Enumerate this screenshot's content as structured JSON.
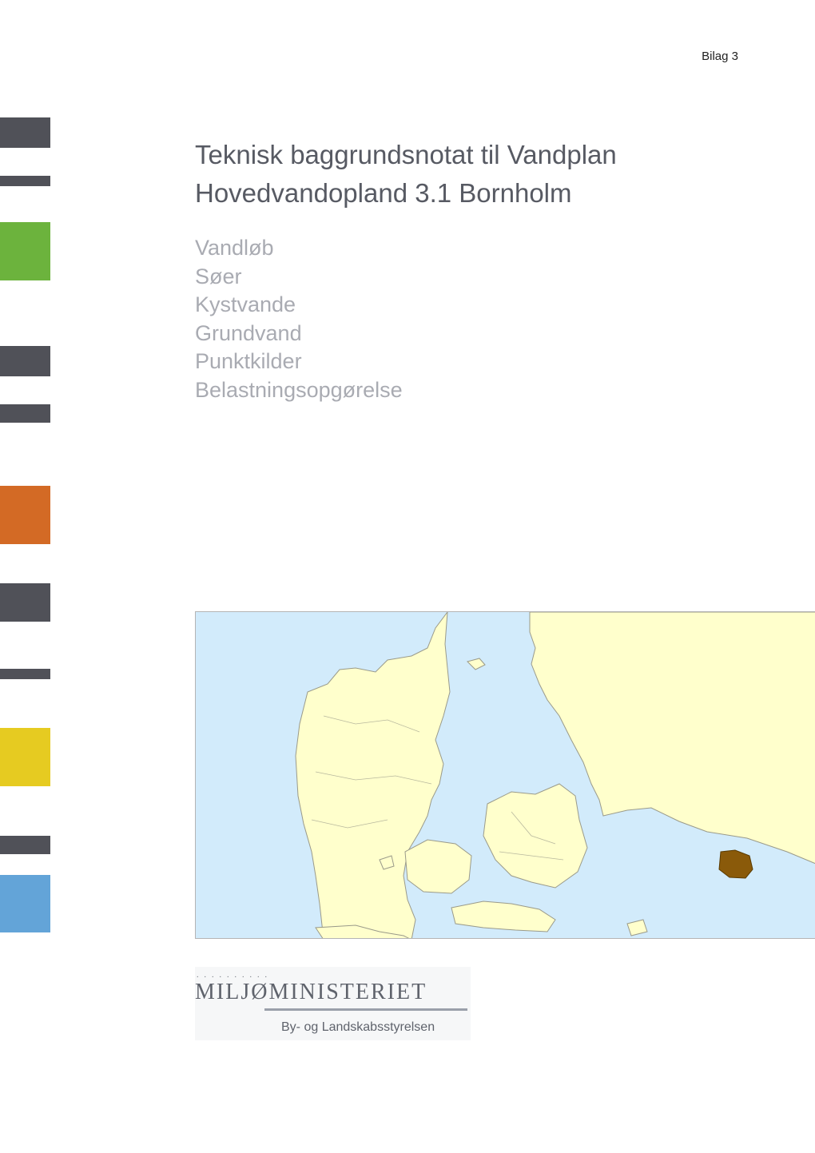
{
  "header": {
    "appendix_label": "Bilag 3"
  },
  "title": {
    "line1": "Teknisk baggrundsnotat til Vandplan",
    "line2": "Hovedvandopland 3.1 Bornholm"
  },
  "topics": [
    "Vandløb",
    "Søer",
    "Kystvande",
    "Grundvand",
    "Punktkilder",
    "Belastningsopgørelse"
  ],
  "sidebar": {
    "colors": {
      "gray": "#505158",
      "green": "#6cb33d",
      "orange": "#d36a25",
      "yellow": "#e6cb21",
      "blue": "#63a4d8"
    }
  },
  "map": {
    "colors": {
      "sea": "#d2ebfb",
      "land": "#ffffcc",
      "border": "#9a9a8a",
      "highlight": "#8a5a0a"
    },
    "highlighted_region": "Bornholm"
  },
  "logo": {
    "dots": "..........",
    "name": "MILJØMINISTERIET",
    "agency": "By- og Landskabsstyrelsen"
  }
}
